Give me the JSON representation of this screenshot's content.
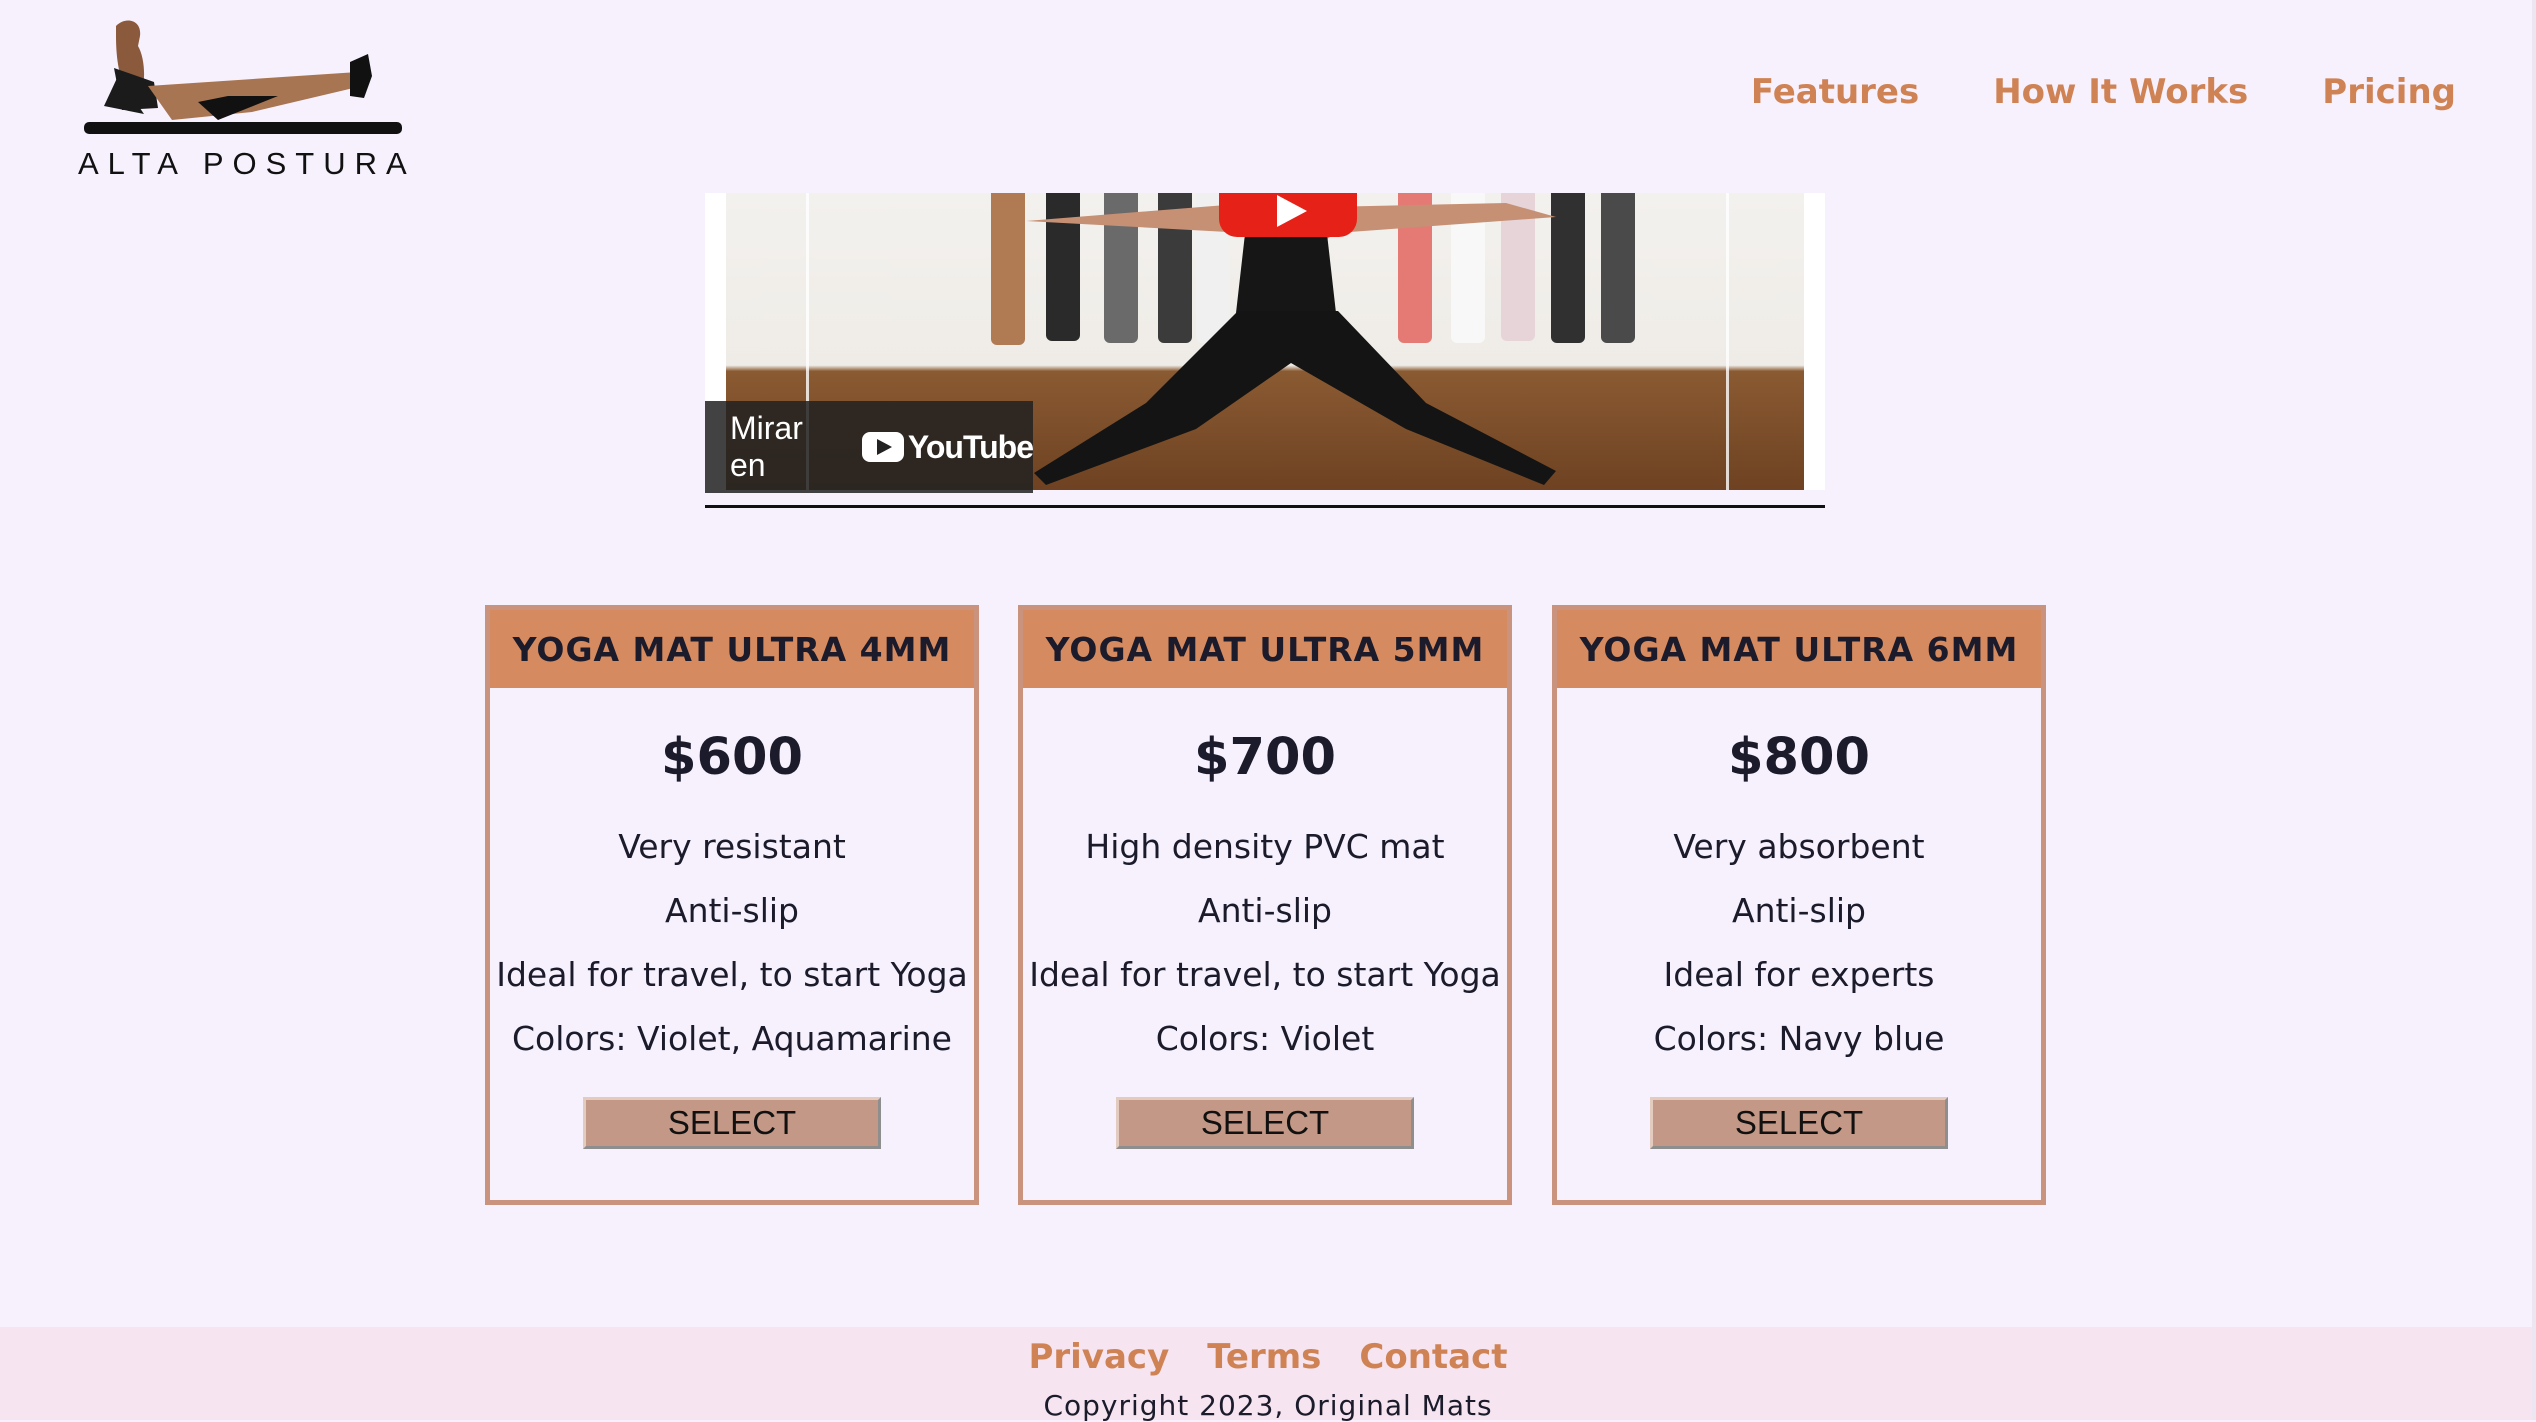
{
  "brand": {
    "name": "ALTA POSTURA"
  },
  "nav": {
    "items": [
      "Features",
      "How It Works",
      "Pricing"
    ]
  },
  "video": {
    "watch_label": "Mirar en",
    "platform": "YouTube",
    "icons": [
      "play-icon",
      "youtube-icon"
    ]
  },
  "plans": [
    {
      "title": "YOGA MAT ULTRA 4MM",
      "price": "$600",
      "features": [
        "Very resistant",
        "Anti-slip",
        "Ideal for travel, to start Yoga",
        "Colors: Violet, Aquamarine"
      ],
      "button": "SELECT"
    },
    {
      "title": "YOGA MAT ULTRA 5MM",
      "price": "$700",
      "features": [
        "High density PVC mat",
        "Anti-slip",
        "Ideal for travel, to start Yoga",
        "Colors: Violet"
      ],
      "button": "SELECT"
    },
    {
      "title": "YOGA MAT ULTRA 6MM",
      "price": "$800",
      "features": [
        "Very absorbent",
        "Anti-slip",
        "Ideal for experts",
        "Colors: Navy blue"
      ],
      "button": "SELECT"
    }
  ],
  "footer": {
    "links": [
      "Privacy",
      "Terms",
      "Contact"
    ],
    "copyright": "Copyright 2023, Original Mats"
  },
  "colors": {
    "background": "#f7f1fd",
    "accent": "#cf8355",
    "card_header": "#d68a5f",
    "card_border": "#c9937e",
    "button": "#c49886",
    "footer_bg": "#f6e5f0"
  }
}
